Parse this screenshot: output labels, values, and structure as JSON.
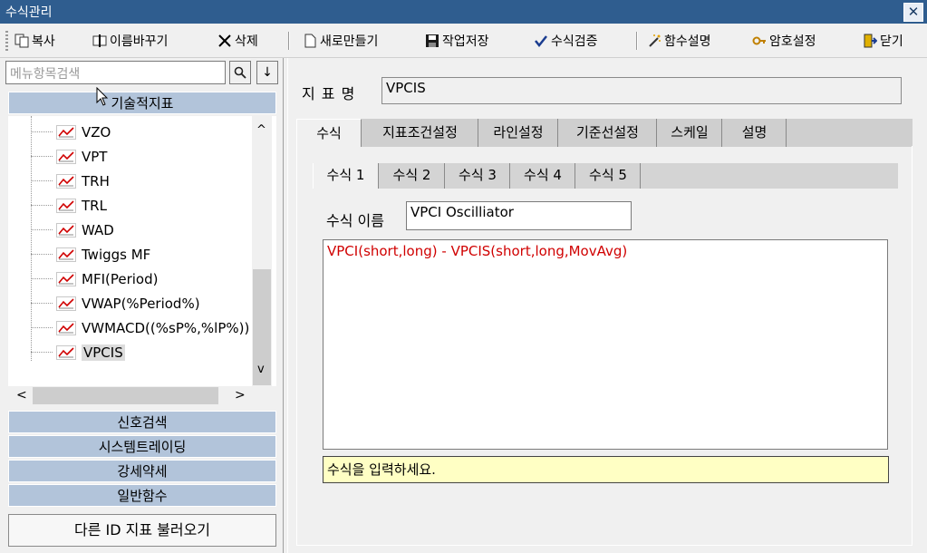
{
  "window": {
    "title": "수식관리",
    "close_glyph": "✕"
  },
  "toolbar": {
    "copy": "복사",
    "rename": "이름바꾸기",
    "delete": "삭제",
    "new": "새로만들기",
    "save": "작업저장",
    "verify": "수식검증",
    "func_help": "함수설명",
    "password": "암호설정",
    "close": "닫기"
  },
  "sidebar": {
    "search_placeholder": "메뉴항목검색",
    "search_glyph": "🔍",
    "down_glyph": "↓",
    "section_tech": "기술적지표",
    "tree_items": [
      "VZO",
      "VPT",
      "TRH",
      "TRL",
      "WAD",
      "Twiggs MF",
      "MFI(Period)",
      "VWAP(%Period%)",
      "VWMACD((%sP%,%lP%))",
      "VPCIS"
    ],
    "selected": "VPCIS",
    "sections": [
      "신호검색",
      "시스템트레이딩",
      "강세약세",
      "일반함수"
    ],
    "call_button": "다른 ID 지표 불러오기",
    "scroll_up": "^",
    "scroll_down": "v",
    "scroll_left": "<",
    "scroll_right": ">"
  },
  "main": {
    "indicator_label": "지 표 명",
    "indicator_name": "VPCIS",
    "tabs": [
      "수식",
      "지표조건설정",
      "라인설정",
      "기준선설정",
      "스케일",
      "설명"
    ],
    "active_tab": "수식",
    "sub_tabs": [
      "수식 1",
      "수식 2",
      "수식 3",
      "수식 4",
      "수식 5"
    ],
    "active_sub_tab": "수식 1",
    "formula_name_label": "수식 이름",
    "formula_name": "VPCI Oscilliator",
    "formula_parts": {
      "f1": "VPCI(",
      "a1": "short,long",
      "f2": ") - VPCIS(",
      "a2": "short,long,MovAvg",
      "f3": ")"
    },
    "status": "수식을 입력하세요."
  },
  "colors": {
    "title_bar": "#2f5d8f",
    "section_header": "#b2c4da",
    "status_bg": "#ffffc4",
    "formula_arg": "#d00000"
  }
}
